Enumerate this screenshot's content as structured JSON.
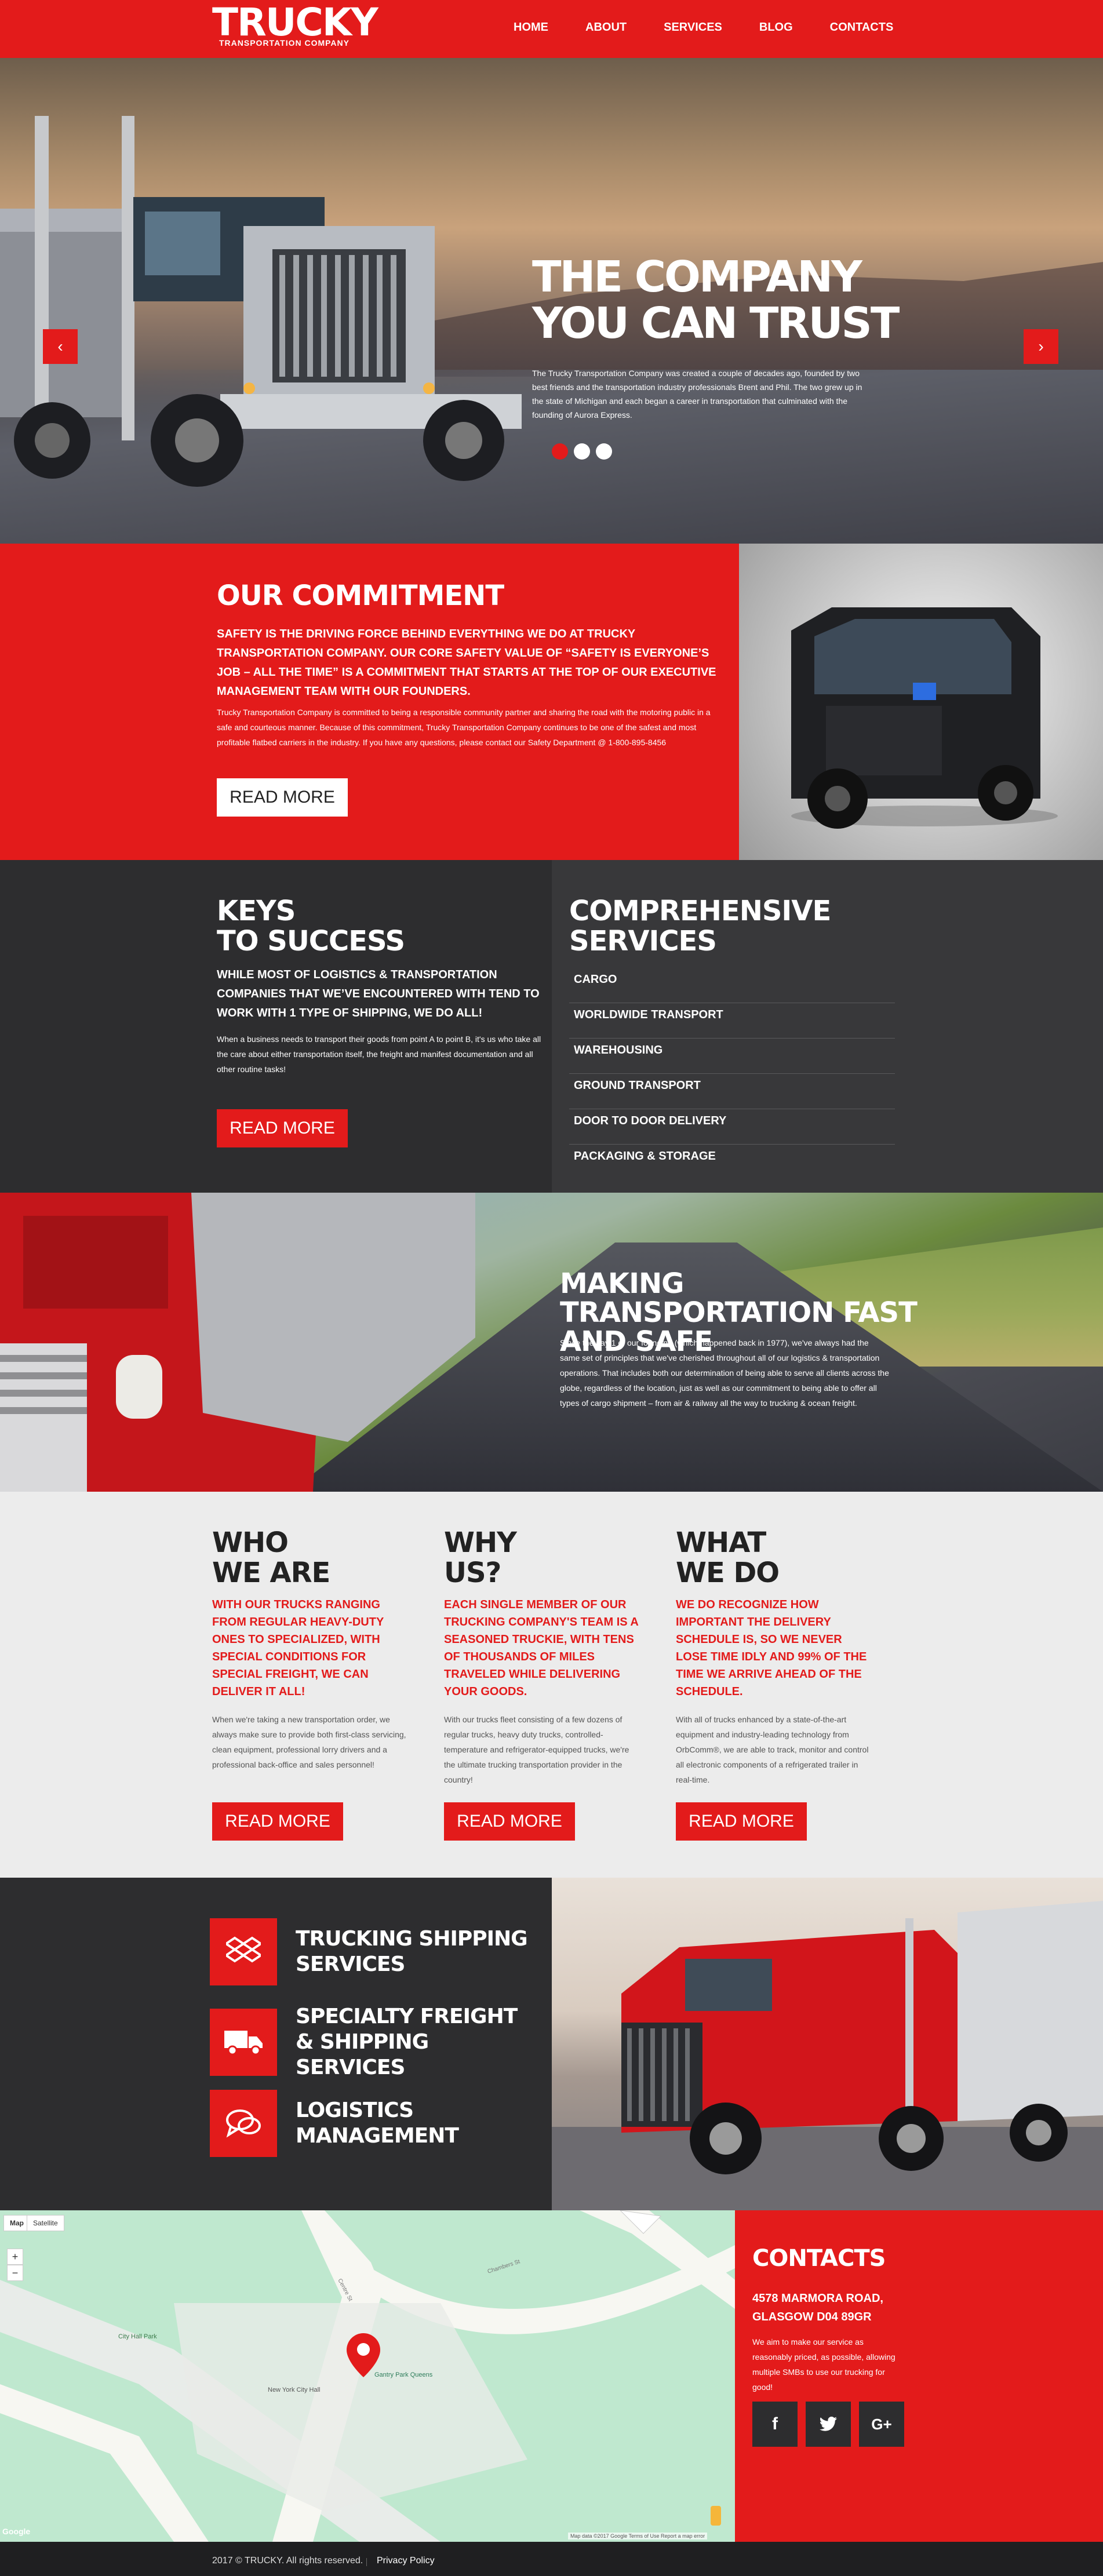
{
  "header": {
    "logo": "TRUCKY",
    "logo_sub": "TRANSPORTATION COMPANY",
    "nav": [
      "HOME",
      "ABOUT",
      "SERVICES",
      "BLOG",
      "CONTACTS"
    ]
  },
  "hero": {
    "title_line1": "THE COMPANY",
    "title_line2": "YOU CAN TRUST",
    "text": "The Trucky Transportation Company was created a couple of decades ago, founded by two best friends and the transportation industry professionals Brent and Phil. The two grew up in the state of Michigan and each began a career in transportation that culminated with the founding of Aurora Express.",
    "prev": "‹",
    "next": "›"
  },
  "commitment": {
    "title": "OUR COMMITMENT",
    "lead": "SAFETY IS THE DRIVING FORCE BEHIND EVERYTHING WE DO AT TRUCKY TRANSPORTATION COMPANY. OUR CORE SAFETY VALUE OF “SAFETY IS EVERYONE’S JOB – ALL THE TIME” IS A COMMITMENT THAT STARTS AT THE TOP OF OUR EXECUTIVE MANAGEMENT TEAM WITH OUR FOUNDERS.",
    "body": "Trucky Transportation Company is committed to being a responsible community partner and sharing the road with the motoring public in a safe and courteous manner. Because of this commitment, Trucky Transportation Company continues to be one of the safest and most profitable flatbed carriers in the industry. If you have any questions, please contact our Safety Department @ 1-800-895-8456",
    "button": "READ MORE"
  },
  "keys": {
    "title_line1": "KEYS",
    "title_line2": "TO SUCCESS",
    "lead": "WHILE MOST OF LOGISTICS & TRANSPORTATION COMPANIES THAT WE’VE ENCOUNTERED WITH TEND TO WORK WITH 1 TYPE OF SHIPPING, WE DO ALL!",
    "body": "When a business needs to transport their goods from point A to point B, it's us who take all the care about either transportation itself, the freight and manifest documentation and all other routine tasks!",
    "button": "READ MORE"
  },
  "services": {
    "title": "COMPREHENSIVE SERVICES",
    "items": [
      "CARGO",
      "WORLDWIDE TRANSPORT",
      "WAREHOUSING",
      "GROUND TRANSPORT",
      "DOOR TO DOOR DELIVERY",
      "PACKAGING & STORAGE"
    ]
  },
  "making": {
    "title": "MAKING TRANSPORTATION FAST AND SAFE",
    "body": "Since the day 1 of our founding (which happened back in 1977), we've always had the same set of principles that we've cherished throughout all of our logistics & transportation operations. That includes both our determination of being able to serve all clients across the globe, regardless of the location, just as well as our commitment to being able to offer all types of cargo shipment – from air & railway all the way to trucking & ocean freight."
  },
  "about": {
    "columns": [
      {
        "title_line1": "WHO",
        "title_line2": "WE ARE",
        "lead": "WITH OUR TRUCKS RANGING FROM REGULAR HEAVY-DUTY ONES TO SPECIALIZED, WITH SPECIAL CONDITIONS FOR SPECIAL FREIGHT, WE CAN DELIVER IT ALL!",
        "body": "When we're taking a new transportation order, we always make sure to provide both first-class servicing, clean equipment, professional lorry drivers and a professional back-office and sales personnel!",
        "button": "READ MORE"
      },
      {
        "title_line1": "WHY",
        "title_line2": "US?",
        "lead": "EACH SINGLE MEMBER OF OUR TRUCKING COMPANY'S TEAM IS A SEASONED TRUCKIE, WITH TENS OF THOUSANDS OF MILES TRAVELED WHILE DELIVERING YOUR GOODS.",
        "body": "With our trucks fleet consisting of a few dozens of regular trucks, heavy duty trucks, controlled-temperature and refrigerator-equipped trucks, we're the ultimate trucking transportation provider in the country!",
        "button": "READ MORE"
      },
      {
        "title_line1": "WHAT",
        "title_line2": "WE DO",
        "lead": "WE DO RECOGNIZE HOW IMPORTANT THE DELIVERY SCHEDULE IS, SO WE NEVER LOSE TIME IDLY AND 99% OF THE TIME WE ARRIVE AHEAD OF THE SCHEDULE.",
        "body": "With all of trucks enhanced by a state-of-the-art equipment and industry-leading technology from OrbComm®, we are able to track, monitor and control all electronic components of a refrigerated trailer in real-time.",
        "button": "READ MORE"
      }
    ]
  },
  "features": {
    "items": [
      {
        "label": "TRUCKING SHIPPING SERVICES",
        "icon": "dropbox-icon"
      },
      {
        "label": "SPECIALTY FREIGHT & SHIPPING SERVICES",
        "icon": "truck-icon"
      },
      {
        "label": "LOGISTICS MANAGEMENT",
        "icon": "chat-icon"
      }
    ]
  },
  "map": {
    "tab_map": "Map",
    "tab_satellite": "Satellite",
    "zoom_in": "+",
    "zoom_out": "−",
    "label_park": "City Hall Park",
    "label_hall": "New York City Hall",
    "label_pin": "Gantry Park Queens",
    "label_street1": "Chambers St",
    "label_street2": "Centre St",
    "google": "Google",
    "footer_text": "Map data ©2017 Google   Terms of Use   Report a map error"
  },
  "contacts": {
    "title": "CONTACTS",
    "address": "4578 MARMORA ROAD, GLASGOW D04 89GR",
    "desc": "We aim to make our service as reasonably priced, as possible, allowing multiple SMBs to use our trucking for good!",
    "social": [
      "f",
      "t",
      "G+"
    ]
  },
  "footer": {
    "copyright": "2017 © TRUCKY. All rights reserved.",
    "privacy": "Privacy Policy"
  },
  "colors": {
    "accent": "#e31b1b",
    "dark": "#2d2d2f",
    "light": "#ececec"
  }
}
